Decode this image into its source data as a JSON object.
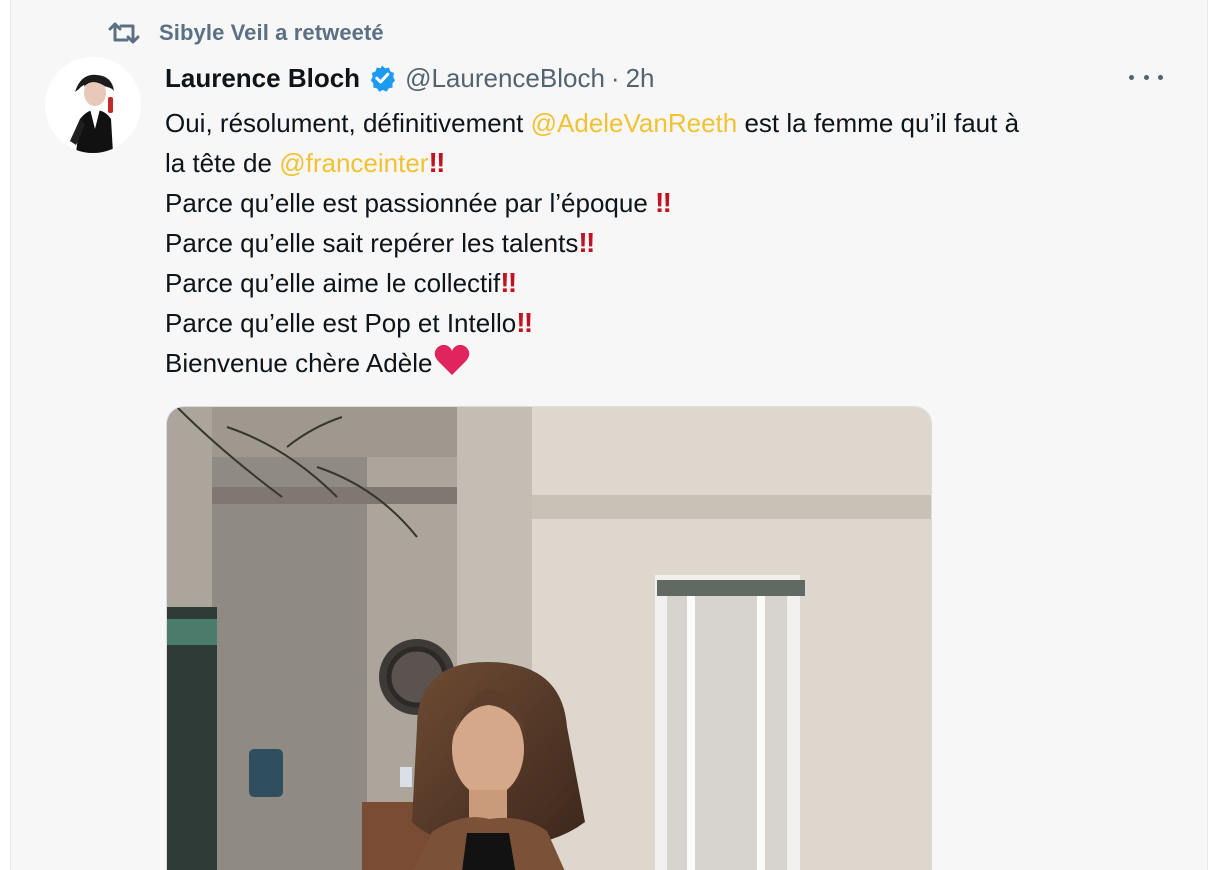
{
  "retweet": {
    "text": "Sibyle Veil a retweeté",
    "icon": "retweet-icon"
  },
  "author": {
    "name": "Laurence Bloch",
    "handle": "@LaurenceBloch",
    "separator": "·",
    "time": "2h",
    "verified": true
  },
  "tweet": {
    "line1_pre": "Oui, résolument, définitivement ",
    "mention1": "@AdeleVanReeth",
    "line1_post": " est la femme qu’il faut à",
    "line2_pre": "la tête de ",
    "mention2": "@franceinter",
    "bang": "‼",
    "line3": "Parce qu’elle est passionnée par l’époque ",
    "line4": "Parce qu’elle sait repérer les talents",
    "line5": "Parce qu’elle aime le collectif",
    "line6": "Parce qu’elle est Pop et Intello",
    "line7": "Bienvenue chère Adèle"
  },
  "colors": {
    "mention": "#f1c232",
    "secondary_text": "#536471",
    "exclamation": "#c1121f",
    "heart": "#e0245e",
    "verified": "#1d9bf0"
  }
}
